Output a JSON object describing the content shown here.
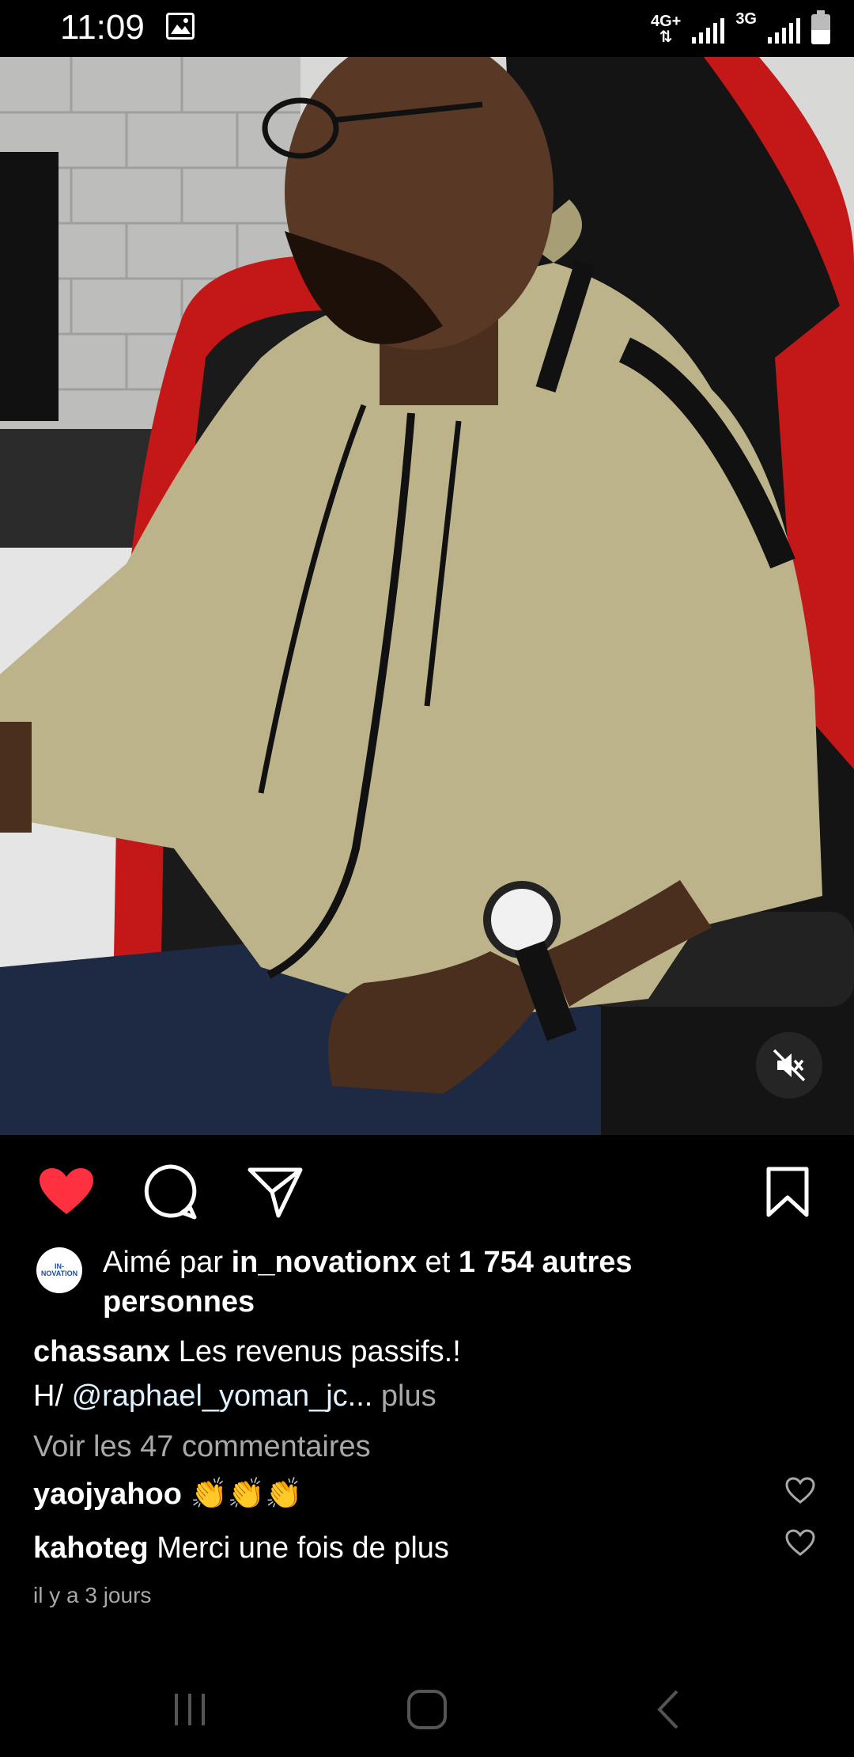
{
  "status_bar": {
    "time": "11:09",
    "network_1": "4G+",
    "network_2": "3G",
    "icons": [
      "image-icon",
      "signal-icon",
      "battery-icon"
    ]
  },
  "post": {
    "media_description_icon": "video-frame",
    "mute_icon": "speaker-muted-icon",
    "actions": {
      "like_icon": "heart-filled-icon",
      "comment_icon": "comment-icon",
      "share_icon": "send-icon",
      "save_icon": "bookmark-icon"
    },
    "liked_by": {
      "avatar_label": "IN-NOVATION",
      "prefix": "Aimé par ",
      "user": "in_novationx",
      "conjunction": " et ",
      "others": "1 754 autres personnes"
    },
    "caption": {
      "author": "chassanx",
      "text": " Les revenus passifs.!",
      "line2_prefix": "H/ ",
      "mention": "@raphael_yoman_jc",
      "ellipsis": "...",
      "more": " plus"
    },
    "view_comments": "Voir les 47 commentaires",
    "comments": [
      {
        "user": "yaojyahoo",
        "text": " 👏👏👏"
      },
      {
        "user": "kahoteg",
        "text": " Merci une fois de plus"
      }
    ],
    "time_ago": "il y a 3 jours"
  },
  "colors": {
    "background": "#000000",
    "like_red": "#ff3040",
    "secondary_text": "#a8a8a8",
    "mention": "#e0f1ff"
  }
}
